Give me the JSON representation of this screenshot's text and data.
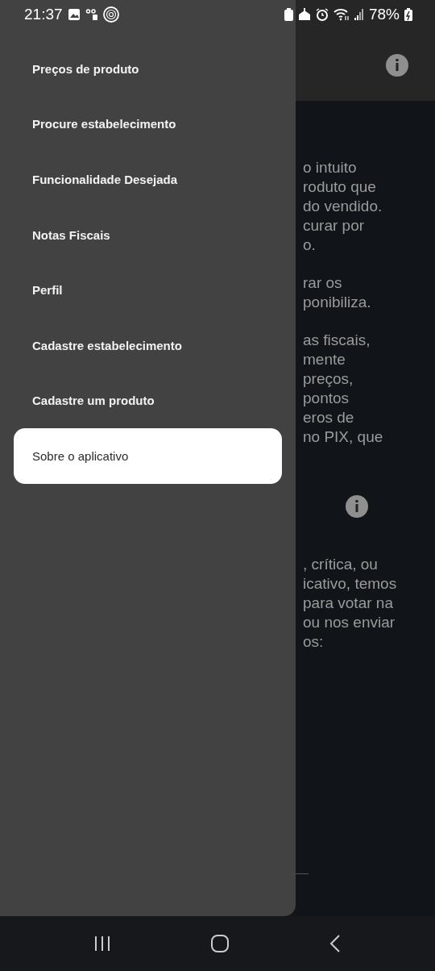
{
  "status_bar": {
    "time": "21:37",
    "battery": "78%"
  },
  "drawer": {
    "items": [
      {
        "label": "Preços de produto",
        "selected": false
      },
      {
        "label": "Procure estabelecimento",
        "selected": false
      },
      {
        "label": "Funcionalidade Desejada",
        "selected": false
      },
      {
        "label": "Notas Fiscais",
        "selected": false
      },
      {
        "label": "Perfil",
        "selected": false
      },
      {
        "label": "Cadastre estabelecimento",
        "selected": false
      },
      {
        "label": "Cadastre um produto",
        "selected": false
      },
      {
        "label": "Sobre o aplicativo",
        "selected": true
      }
    ]
  },
  "background": {
    "sections": [
      {
        "lines": [
          "o intuito",
          "roduto que",
          "do vendido.",
          "curar por",
          "o."
        ]
      },
      {
        "lines": [
          "rar os",
          "ponibiliza."
        ]
      },
      {
        "lines": [
          "as fiscais,",
          "mente",
          "preços,",
          "pontos",
          "eros de",
          "no PIX, que"
        ]
      },
      {
        "info_icon": true,
        "lines": [
          ", crítica, ou",
          "icativo, temos",
          "para votar na",
          "ou nos enviar",
          "os:"
        ]
      }
    ]
  }
}
